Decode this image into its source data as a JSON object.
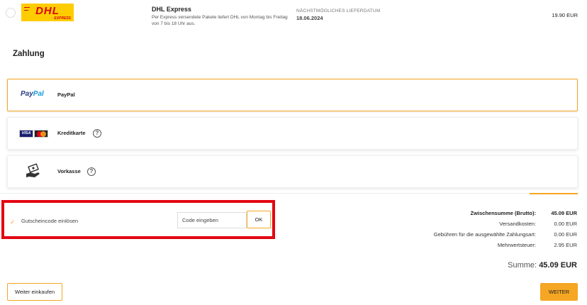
{
  "shipping": {
    "logo_text": "DHL",
    "logo_sub": "EXPRESS",
    "title": "DHL Express",
    "description": "Per Express versendete Pakete liefert DHL von Montag bis Freitag von 7 bis 18 Uhr aus.",
    "date_label": "NÄCHSTMÖGLICHES LIEFERDATUM",
    "date": "18.06.2024",
    "price": "19.90 EUR"
  },
  "payment": {
    "title": "Zahlung",
    "options": [
      {
        "label": "PayPal",
        "logo_part1": "Pay",
        "logo_part2": "Pal",
        "selected": true
      },
      {
        "label": "Kreditkarte",
        "card_text": "VISA",
        "help": "?"
      },
      {
        "label": "Vorkasse",
        "help": "?"
      }
    ]
  },
  "coupon": {
    "checkbox_mark": "✓",
    "label": "Gutscheincode einlösen",
    "placeholder": "Code eingeben",
    "ok_label": "OK"
  },
  "totals": {
    "rows": [
      {
        "label": "Zwischensumme (Brutto):",
        "value": "45.09 EUR"
      },
      {
        "label": "Versandkosten:",
        "value": "0.00 EUR"
      },
      {
        "label": "Gebühren für die ausgewählte Zahlungsart:",
        "value": "0.00 EUR"
      },
      {
        "label": "Mehrwertsteuer:",
        "value": "2.95 EUR"
      }
    ],
    "grand_label": "Summe:",
    "grand_value": "45.09 EUR"
  },
  "buttons": {
    "continue_shopping": "Weiter einkaufen",
    "next": "WEITER"
  },
  "colors": {
    "accent": "#f5a623",
    "highlight": "#e30613",
    "dhl_yellow": "#ffcc00",
    "dhl_red": "#d40511"
  }
}
